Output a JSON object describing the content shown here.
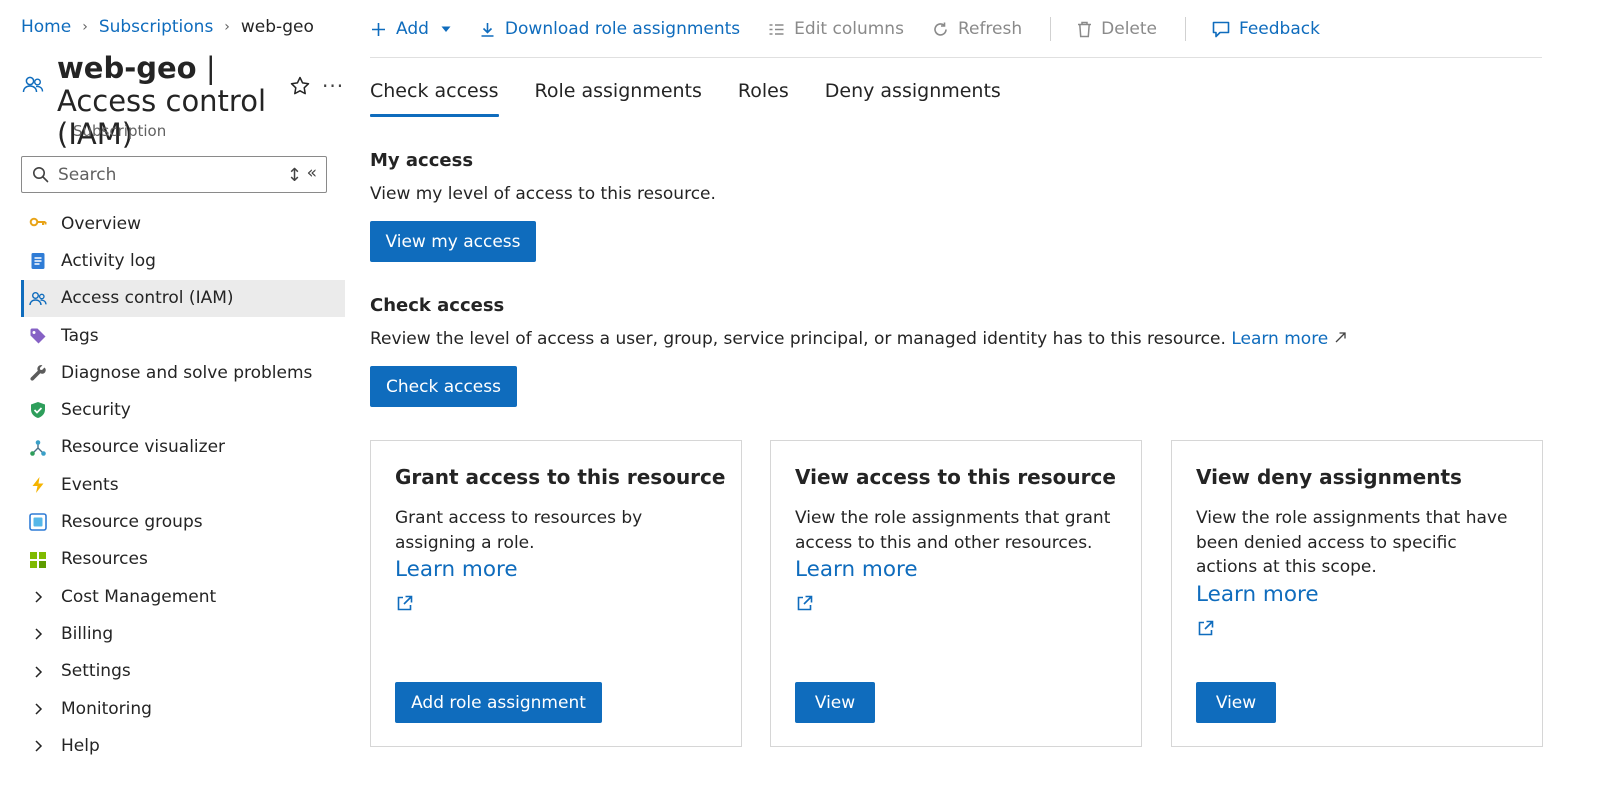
{
  "breadcrumb": {
    "home": "Home",
    "subscriptions": "Subscriptions",
    "current": "web-geo",
    "separator": "›"
  },
  "title": {
    "resource": "web-geo",
    "rest": " | Access control (IAM)",
    "subtitle": "Subscription"
  },
  "search": {
    "placeholder": "Search"
  },
  "nav": {
    "items": [
      {
        "label": "Overview",
        "icon": "key-icon"
      },
      {
        "label": "Activity log",
        "icon": "activity-log-icon"
      },
      {
        "label": "Access control (IAM)",
        "icon": "people-icon",
        "active": true
      },
      {
        "label": "Tags",
        "icon": "tag-icon"
      },
      {
        "label": "Diagnose and solve problems",
        "icon": "wrench-icon"
      },
      {
        "label": "Security",
        "icon": "shield-icon"
      },
      {
        "label": "Resource visualizer",
        "icon": "visualizer-icon"
      },
      {
        "label": "Events",
        "icon": "lightning-icon"
      },
      {
        "label": "Resource groups",
        "icon": "resource-group-icon"
      },
      {
        "label": "Resources",
        "icon": "grid-icon"
      },
      {
        "label": "Cost Management",
        "icon": "chevron-right-icon"
      },
      {
        "label": "Billing",
        "icon": "chevron-right-icon"
      },
      {
        "label": "Settings",
        "icon": "chevron-right-icon"
      },
      {
        "label": "Monitoring",
        "icon": "chevron-right-icon"
      },
      {
        "label": "Help",
        "icon": "chevron-right-icon"
      }
    ]
  },
  "toolbar": {
    "add": "Add",
    "download": "Download role assignments",
    "edit_columns": "Edit columns",
    "refresh": "Refresh",
    "delete": "Delete",
    "feedback": "Feedback"
  },
  "tabs": [
    "Check access",
    "Role assignments",
    "Roles",
    "Deny assignments"
  ],
  "my_access": {
    "heading": "My access",
    "description": "View my level of access to this resource.",
    "button": "View my access"
  },
  "check_access": {
    "heading": "Check access",
    "description": "Review the level of access a user, group, service principal, or managed identity has to this resource.",
    "learn_more": "Learn more",
    "button": "Check access"
  },
  "cards": [
    {
      "title": "Grant access to this resource",
      "body": "Grant access to resources by assigning a role.",
      "link": "Learn more",
      "button": "Add role assignment"
    },
    {
      "title": "View access to this resource",
      "body": "View the role assignments that grant access to this and other resources.",
      "link": "Learn more",
      "button": "View"
    },
    {
      "title": "View deny assignments",
      "body": "View the role assignments that have been denied access to specific actions at this scope.",
      "link": "Learn more",
      "button": "View"
    }
  ],
  "colors": {
    "accent": "#0f6cbd",
    "nav_active_bg": "#ebebeb",
    "text": "#242424",
    "muted": "#616161"
  }
}
